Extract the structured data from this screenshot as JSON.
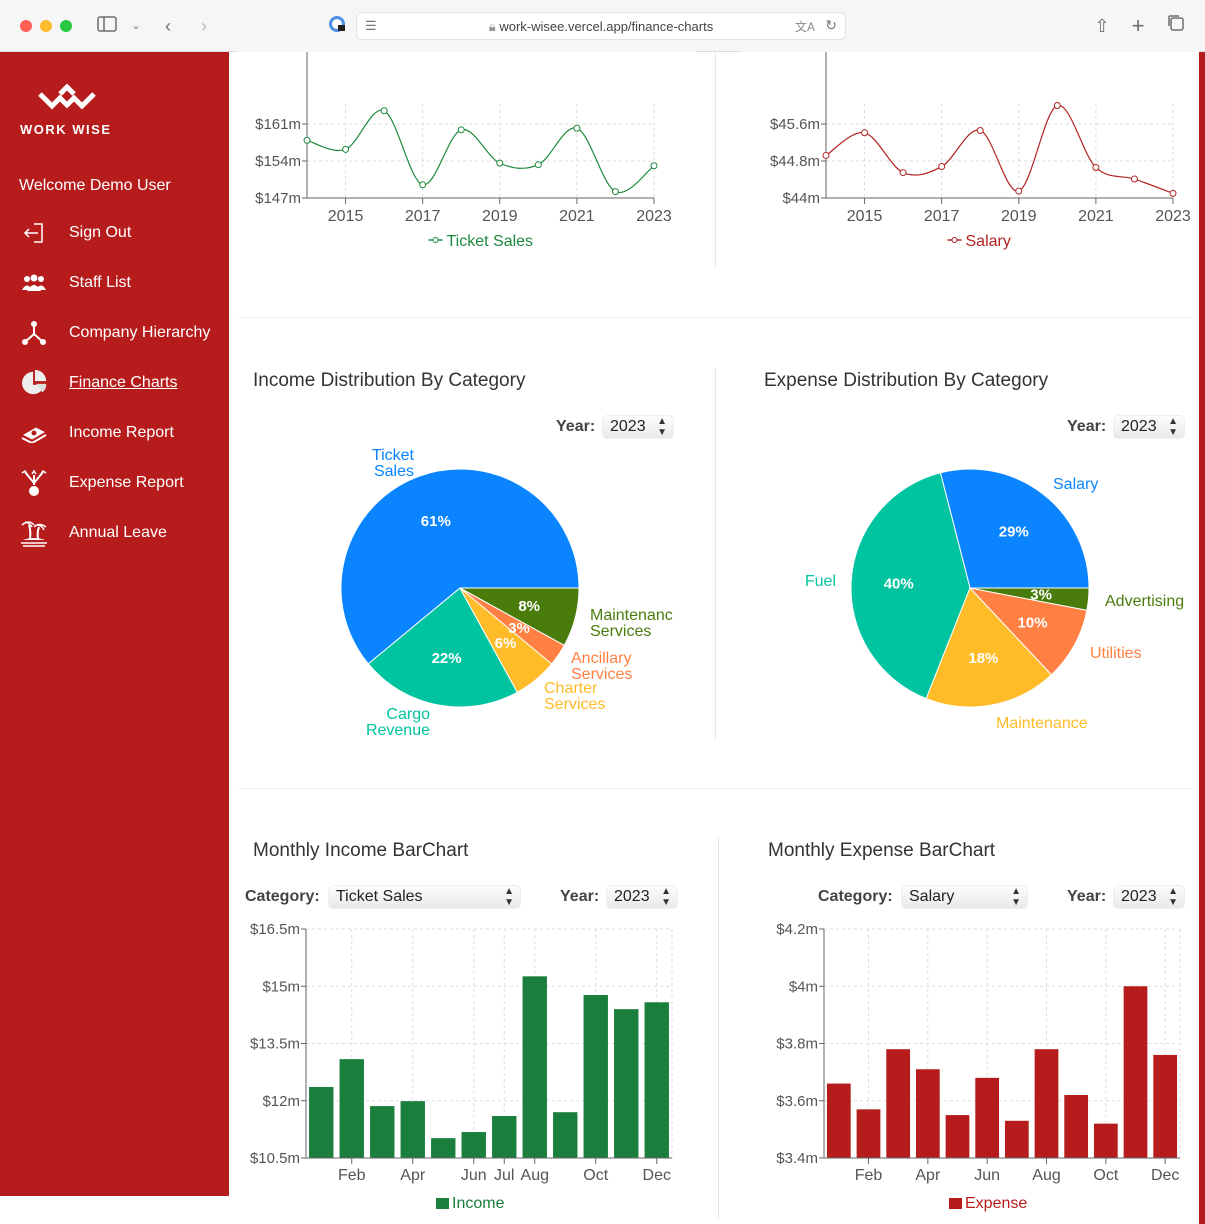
{
  "browser": {
    "url": "work-wisee.vercel.app/finance-charts",
    "colors": {
      "close": "#fe5f57",
      "minimize": "#febc2e",
      "maximize": "#28c840"
    }
  },
  "sidebar": {
    "logo_text": "WORK WISE",
    "welcome": "Welcome Demo User",
    "items": [
      {
        "label": "Sign Out",
        "icon": "sign-out-icon",
        "active": false
      },
      {
        "label": "Staff List",
        "icon": "staff-icon",
        "active": false
      },
      {
        "label": "Company Hierarchy",
        "icon": "hierarchy-icon",
        "active": false
      },
      {
        "label": "Finance Charts",
        "icon": "pie-chart-icon",
        "active": true
      },
      {
        "label": "Income Report",
        "icon": "money-icon",
        "active": false
      },
      {
        "label": "Expense Report",
        "icon": "expense-icon",
        "active": false
      },
      {
        "label": "Annual Leave",
        "icon": "island-icon",
        "active": false
      }
    ],
    "color": "#b71c1c"
  },
  "labels": {
    "year": "Year:",
    "category": "Category:"
  },
  "income_pie": {
    "title": "Income Distribution By Category",
    "year": "2023"
  },
  "expense_pie": {
    "title": "Expense Distribution By Category",
    "year": "2023"
  },
  "income_bar": {
    "title": "Monthly Income BarChart",
    "category": "Ticket Sales",
    "year": "2023"
  },
  "expense_bar": {
    "title": "Monthly Expense BarChart",
    "category": "Salary",
    "year": "2023"
  },
  "chart_data": [
    {
      "id": "ticket-sales-line",
      "type": "line",
      "title": "",
      "x": [
        2014,
        2015,
        2016,
        2017,
        2018,
        2019,
        2020,
        2021,
        2022,
        2023
      ],
      "xticks": [
        "2015",
        "2017",
        "2019",
        "2021",
        "2023"
      ],
      "series": [
        {
          "name": "Ticket Sales",
          "color": "#1e8a3e",
          "values": [
            157.9,
            156.2,
            163.5,
            149.5,
            159.9,
            153.6,
            153.3,
            160.2,
            148.2,
            153.1
          ]
        }
      ],
      "ylim": [
        147,
        161
      ],
      "yticks": [
        "$147m",
        "$154m",
        "$161m"
      ],
      "ytick_values": [
        147,
        154,
        161
      ],
      "grid": true,
      "legend": "bottom"
    },
    {
      "id": "salary-line",
      "type": "line",
      "title": "",
      "x": [
        2014,
        2015,
        2016,
        2017,
        2018,
        2019,
        2020,
        2021,
        2022,
        2023
      ],
      "xticks": [
        "2015",
        "2017",
        "2019",
        "2021",
        "2023"
      ],
      "series": [
        {
          "name": "Salary",
          "color": "#b22222",
          "values": [
            44.92,
            45.41,
            44.55,
            44.68,
            45.46,
            44.15,
            46.0,
            44.66,
            44.41,
            44.1
          ]
        }
      ],
      "ylim": [
        44,
        45.6
      ],
      "yticks": [
        "$44m",
        "$44.8m",
        "$45.6m"
      ],
      "ytick_values": [
        44,
        44.8,
        45.6
      ],
      "grid": true,
      "legend": "bottom"
    },
    {
      "id": "income-pie",
      "type": "pie",
      "title": "Income Distribution By Category",
      "slices": [
        {
          "name": "Ticket Sales",
          "label_lines": [
            "Ticket",
            "Sales"
          ],
          "value": 61,
          "pct": "61%",
          "color": "#0a84ff"
        },
        {
          "name": "Cargo Revenue",
          "label_lines": [
            "Cargo",
            "Revenue"
          ],
          "value": 22,
          "pct": "22%",
          "color": "#00c49f"
        },
        {
          "name": "Charter Services",
          "label_lines": [
            "Charter",
            "Services"
          ],
          "value": 6,
          "pct": "6%",
          "color": "#ffbb28"
        },
        {
          "name": "Ancillary Services",
          "label_lines": [
            "Ancillary",
            "Services"
          ],
          "value": 3,
          "pct": "3%",
          "color": "#ff8042"
        },
        {
          "name": "Maintenance Services",
          "label_lines": [
            "Maintenanc",
            "Services"
          ],
          "value": 8,
          "pct": "8%",
          "color": "#4a7c0c"
        }
      ]
    },
    {
      "id": "expense-pie",
      "type": "pie",
      "title": "Expense Distribution By Category",
      "slices": [
        {
          "name": "Salary",
          "label_lines": [
            "Salary"
          ],
          "value": 29,
          "pct": "29%",
          "color": "#0a84ff"
        },
        {
          "name": "Fuel",
          "label_lines": [
            "Fuel"
          ],
          "value": 40,
          "pct": "40%",
          "color": "#00c49f"
        },
        {
          "name": "Maintenance",
          "label_lines": [
            "Maintenance"
          ],
          "value": 18,
          "pct": "18%",
          "color": "#ffbb28"
        },
        {
          "name": "Utilities",
          "label_lines": [
            "Utilities"
          ],
          "value": 10,
          "pct": "10%",
          "color": "#ff8042"
        },
        {
          "name": "Advertising",
          "label_lines": [
            "Advertising"
          ],
          "value": 3,
          "pct": "3%",
          "color": "#4a7c0c"
        }
      ]
    },
    {
      "id": "income-bar",
      "type": "bar",
      "title": "Monthly Income BarChart",
      "categories": [
        "Jan",
        "Feb",
        "Mar",
        "Apr",
        "May",
        "Jun",
        "Jul",
        "Aug",
        "Sep",
        "Oct",
        "Nov",
        "Dec"
      ],
      "xticks_shown": [
        "Feb",
        "Apr",
        "Jun",
        "Jul",
        "Aug",
        "Oct",
        "Dec"
      ],
      "series": [
        {
          "name": "Income",
          "color": "#1a7f3c",
          "values": [
            12.36,
            13.09,
            11.86,
            11.99,
            11.02,
            11.18,
            11.6,
            15.26,
            11.7,
            14.77,
            14.4,
            14.58
          ]
        }
      ],
      "ylim": [
        10.5,
        16.5
      ],
      "yticks": [
        "$10.5m",
        "$12m",
        "$13.5m",
        "$15m",
        "$16.5m"
      ],
      "ytick_values": [
        10.5,
        12,
        13.5,
        15,
        16.5
      ],
      "grid": true,
      "legend": "bottom"
    },
    {
      "id": "expense-bar",
      "type": "bar",
      "title": "Monthly Expense BarChart",
      "categories": [
        "Jan",
        "Feb",
        "Mar",
        "Apr",
        "May",
        "Jun",
        "Jul",
        "Aug",
        "Sep",
        "Oct",
        "Nov",
        "Dec"
      ],
      "xticks_shown": [
        "Feb",
        "Apr",
        "Jun",
        "Aug",
        "Oct",
        "Dec"
      ],
      "series": [
        {
          "name": "Expense",
          "color": "#b71c1c",
          "values": [
            3.66,
            3.57,
            3.78,
            3.71,
            3.55,
            3.68,
            3.53,
            3.78,
            3.62,
            3.52,
            4.0,
            3.76
          ]
        }
      ],
      "ylim": [
        3.4,
        4.2
      ],
      "yticks": [
        "$3.4m",
        "$3.6m",
        "$3.8m",
        "$4m",
        "$4.2m"
      ],
      "ytick_values": [
        3.4,
        3.6,
        3.8,
        4.0,
        4.2
      ],
      "grid": true,
      "legend": "bottom"
    }
  ]
}
